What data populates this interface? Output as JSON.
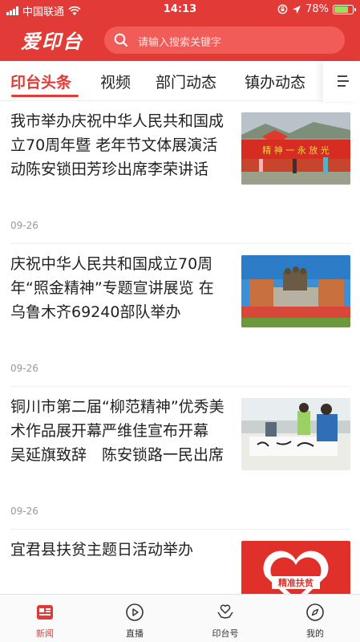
{
  "status_bar": {
    "carrier": "中国联通",
    "time": "14:13",
    "battery": "78%",
    "battery_level": 0.78
  },
  "header": {
    "logo": "爱印台",
    "search_placeholder": "请输入搜索关键字"
  },
  "tabs": [
    {
      "label": "印台头条",
      "active": true
    },
    {
      "label": "视频"
    },
    {
      "label": "部门动态"
    },
    {
      "label": "镇办动态"
    }
  ],
  "news": [
    {
      "title": "我市举办庆祝中华人民共和国成立70周年暨 老年节文体展演活动陈安锁田芳珍出席李荣讲话",
      "date": "09-26",
      "image_text": "精  神 一 永 放 光"
    },
    {
      "title": "庆祝中华人民共和国成立70周年“照金精神”专题宣讲展览 在乌鲁木齐69240部队举办",
      "date": "09-26"
    },
    {
      "title": "铜川市第二届“柳范精神”优秀美术作品展开幕严维佳宣布开幕　吴延旗致辞　陈安锁路一民出席",
      "date": "09-26"
    },
    {
      "title": "宜君县扶贫主题日活动举办",
      "image_text": "精准扶贫"
    }
  ],
  "bottom_nav": [
    {
      "label": "新闻",
      "icon": "news-icon",
      "active": true
    },
    {
      "label": "直播",
      "icon": "play-icon"
    },
    {
      "label": "印台号",
      "icon": "heart-hands-icon"
    },
    {
      "label": "我的",
      "icon": "compass-icon"
    }
  ],
  "colors": {
    "brand": "#e23a36"
  }
}
